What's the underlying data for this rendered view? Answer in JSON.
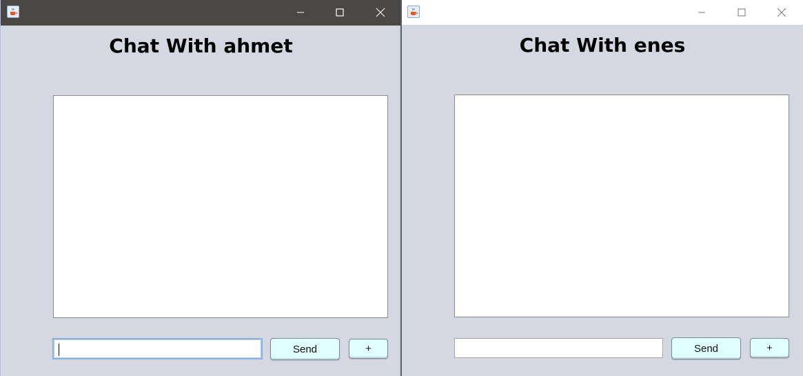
{
  "windows": [
    {
      "title": "Chat With ahmet",
      "send_label": "Send",
      "plus_label": "+",
      "input_value": "",
      "theme": {
        "titlebar_bg": "#4a4745",
        "titlebar_fg": "#ffffff",
        "active": true
      }
    },
    {
      "title": "Chat With enes",
      "send_label": "Send",
      "plus_label": "+",
      "input_value": "",
      "theme": {
        "titlebar_bg": "#ffffff",
        "titlebar_fg": "#555555",
        "active": false
      }
    }
  ],
  "icons": {
    "app": "java-coffee-cup-icon",
    "minimize": "minimize-icon",
    "maximize": "maximize-icon",
    "close": "close-icon"
  },
  "colors": {
    "window_bg": "#d5d8e1",
    "button_bg": "#e0ffff",
    "chat_area_bg": "#ffffff"
  }
}
